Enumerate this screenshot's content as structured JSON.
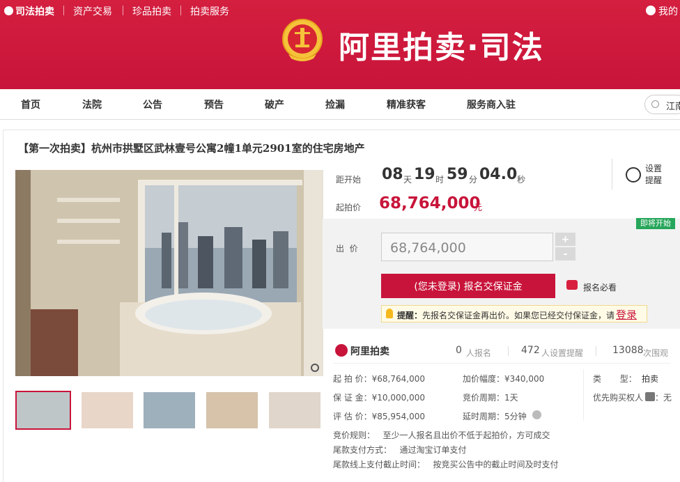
{
  "top_links": {
    "judicial": "司法拍卖",
    "assets": "资产交易",
    "treasures": "珍品拍卖",
    "services": "拍卖服务",
    "mine": "我的"
  },
  "brand": {
    "title": "阿里拍卖·司法",
    "accent": "#c8143a"
  },
  "nav": [
    "首页",
    "法院",
    "公告",
    "预告",
    "破产",
    "捡漏",
    "精准获客",
    "服务商入驻"
  ],
  "search": {
    "value": "江南"
  },
  "listing": {
    "title": "【第一次拍卖】杭州市拱墅区武林壹号公寓2幢1单元2901室的住宅房地产"
  },
  "countdown": {
    "label": "距开始",
    "days": "08",
    "days_unit": "天",
    "hours": "19",
    "hours_unit": "时",
    "minutes": "59",
    "minutes_unit": "分",
    "seconds": "04.0",
    "seconds_unit": "秒",
    "reminder_label": "设置\n提醒"
  },
  "start_price": {
    "label": "起拍价",
    "value": "68,764,000",
    "unit": "元"
  },
  "badge": "即将开始",
  "bid": {
    "label": "出  价",
    "value": "68,764,000",
    "plus": "+",
    "minus": "-"
  },
  "deposit_button": "(您未登录) 报名交保证金",
  "must_read": "报名必看",
  "tip": {
    "prefix": "提醒：",
    "text": "先报名交保证金再出价。如果您已经交付保证金，请",
    "login": "登录"
  },
  "stats": {
    "logo": "阿里拍卖",
    "signups": "0",
    "signups_label": "人报名",
    "reminders": "472",
    "reminders_label": "人设置提醒",
    "views": "13088",
    "views_label": "次围观"
  },
  "details": {
    "start_price": "起 拍 价：¥68,764,000",
    "deposit": "保 证 金：¥10,000,000",
    "valuation": "评 估 价：¥85,954,000",
    "increment": "加价幅度：¥340,000",
    "cycle": "竞价周期：1天",
    "extension": "延时周期：5分钟",
    "type_label": "类       型：",
    "type_value": "拍卖",
    "priority": "优先购买权人",
    "priority_value": "：无",
    "rule": "竞价规则：   至少一人报名且出价不低于起拍价，方可成交",
    "payment": "尾款支付方式：   通过淘宝订单支付",
    "deadline": "尾款线上支付截止时间：   按竞买公告中的截止时间及时支付"
  }
}
